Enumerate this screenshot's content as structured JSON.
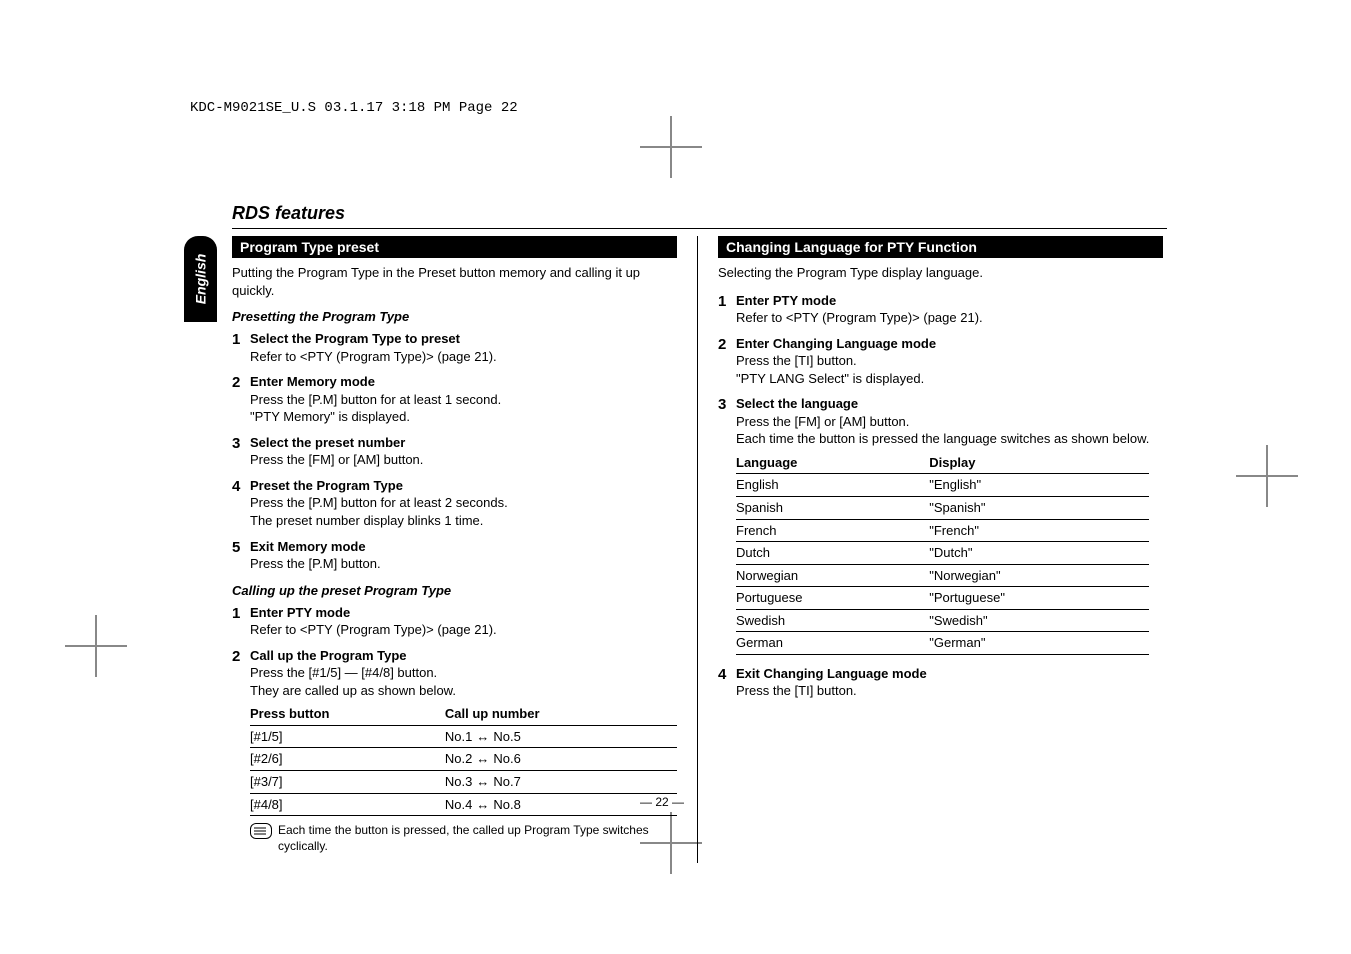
{
  "header_line": "KDC-M9021SE_U.S  03.1.17  3:18 PM  Page 22",
  "side_tab": "English",
  "section_title": "RDS features",
  "page_number": "— 22 —",
  "left": {
    "bar_title": "Program Type preset",
    "intro": "Putting the Program Type in the Preset button memory and calling it up quickly.",
    "subhead1": "Presetting the Program Type",
    "steps1": [
      {
        "n": "1",
        "title": "Select the Program Type to preset",
        "body": "Refer to <PTY (Program Type)> (page 21)."
      },
      {
        "n": "2",
        "title": "Enter Memory mode",
        "body": "Press the [P.M] button for at least 1 second.\n\"PTY Memory\" is displayed."
      },
      {
        "n": "3",
        "title": "Select the preset number",
        "body": "Press the [FM] or [AM] button."
      },
      {
        "n": "4",
        "title": "Preset the Program Type",
        "body": "Press the [P.M] button for at least 2 seconds.\nThe preset number display blinks 1 time."
      },
      {
        "n": "5",
        "title": "Exit Memory mode",
        "body": "Press the [P.M] button."
      }
    ],
    "subhead2": "Calling up the preset Program Type",
    "steps2": [
      {
        "n": "1",
        "title": "Enter PTY mode",
        "body": "Refer to <PTY (Program Type)> (page 21)."
      },
      {
        "n": "2",
        "title": "Call up the Program Type",
        "body": "Press the [#1/5] — [#4/8] button.\nThey are called up as shown below."
      }
    ],
    "table_head": {
      "c1": "Press button",
      "c2": "Call up number"
    },
    "table_rows": [
      {
        "c1": "[#1/5]",
        "a": "No.1",
        "b": "No.5"
      },
      {
        "c1": "[#2/6]",
        "a": "No.2",
        "b": "No.6"
      },
      {
        "c1": "[#3/7]",
        "a": "No.3",
        "b": "No.7"
      },
      {
        "c1": "[#4/8]",
        "a": "No.4",
        "b": "No.8"
      }
    ],
    "note": "Each time the button is pressed, the called up Program Type switches cyclically."
  },
  "right": {
    "bar_title": "Changing Language for PTY Function",
    "intro": "Selecting the Program Type display language.",
    "steps": [
      {
        "n": "1",
        "title": "Enter PTY mode",
        "body": "Refer to <PTY (Program Type)> (page 21)."
      },
      {
        "n": "2",
        "title": "Enter Changing Language mode",
        "body": "Press the [TI] button.\n\"PTY LANG Select\" is displayed."
      },
      {
        "n": "3",
        "title": "Select the language",
        "body": "Press the [FM] or [AM] button.\nEach time the button is pressed the language switches as shown below."
      }
    ],
    "table_head": {
      "c1": "Language",
      "c2": "Display"
    },
    "table_rows": [
      {
        "c1": "English",
        "c2": "\"English\""
      },
      {
        "c1": "Spanish",
        "c2": "\"Spanish\""
      },
      {
        "c1": "French",
        "c2": "\"French\""
      },
      {
        "c1": "Dutch",
        "c2": "\"Dutch\""
      },
      {
        "c1": "Norwegian",
        "c2": "\"Norwegian\""
      },
      {
        "c1": "Portuguese",
        "c2": "\"Portuguese\""
      },
      {
        "c1": "Swedish",
        "c2": "\"Swedish\""
      },
      {
        "c1": "German",
        "c2": "\"German\""
      }
    ],
    "step4": {
      "n": "4",
      "title": "Exit Changing Language mode",
      "body": "Press the [TI] button."
    }
  }
}
